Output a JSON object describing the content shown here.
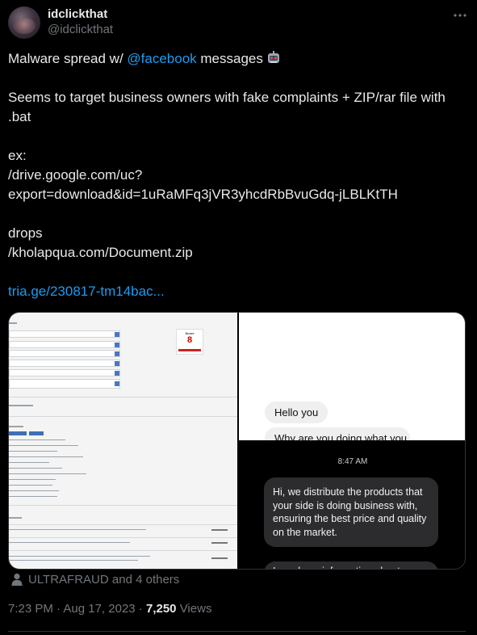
{
  "author": {
    "display_name": "idclickthat",
    "handle": "@idclickthat"
  },
  "tweet": {
    "lines": [
      {
        "prefix": "Malware spread w/ ",
        "mention": "@facebook",
        "suffix": " messages",
        "emoji": "robot-emoji"
      },
      {
        "text": ""
      },
      {
        "text": "Seems to target business owners with fake complaints + ZIP/rar file with"
      },
      {
        "text": ".bat"
      },
      {
        "text": ""
      },
      {
        "text": "ex:"
      },
      {
        "text": "/drive.google.com/uc?"
      },
      {
        "text": "export=download&id=1uRaMFq3jVR3yhcdRbBvuGdq-jLBLKtTH"
      },
      {
        "text": ""
      },
      {
        "text": "drops"
      },
      {
        "text": "/kholapqua.com/Document.zip"
      },
      {
        "text": ""
      }
    ],
    "link": "tria.ge/230817-tm14bac..."
  },
  "media": {
    "scan": {
      "score_label": "Score",
      "score_value": "8",
      "accent": "#c22222"
    },
    "chat_top": {
      "greeting": "Hello you",
      "partial": "Why are you doing what you"
    },
    "chat_bottom": {
      "time": "8:47 AM",
      "message": "Hi, we distribute the products that your side is doing business with, ensuring the best price and quality on the market.",
      "partial": "I send you information about"
    }
  },
  "tagged": {
    "icon": "person-icon",
    "text": "ULTRAFRAUD and 4 others"
  },
  "meta": {
    "time": "7:23 PM",
    "separator": " · ",
    "date": "Aug 17, 2023",
    "views_count": "7,250",
    "views_label": " Views"
  },
  "colors": {
    "background": "#000000",
    "text": "#e7e9ea",
    "muted": "#71767b",
    "link": "#1d9bf0",
    "divider": "#2f3336"
  }
}
